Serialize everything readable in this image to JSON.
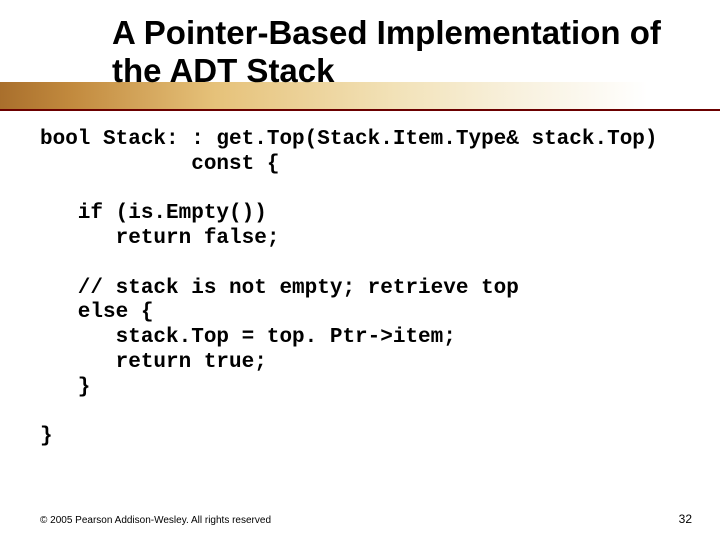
{
  "title": "A Pointer-Based Implementation of the ADT Stack",
  "code": "bool Stack: : get.Top(Stack.Item.Type& stack.Top)\n            const {\n\n   if (is.Empty())\n      return false;\n\n   // stack is not empty; retrieve top\n   else {\n      stack.Top = top. Ptr->item;\n      return true;\n   }\n\n}",
  "footer": "© 2005 Pearson Addison-Wesley. All rights reserved",
  "page_number": "32"
}
